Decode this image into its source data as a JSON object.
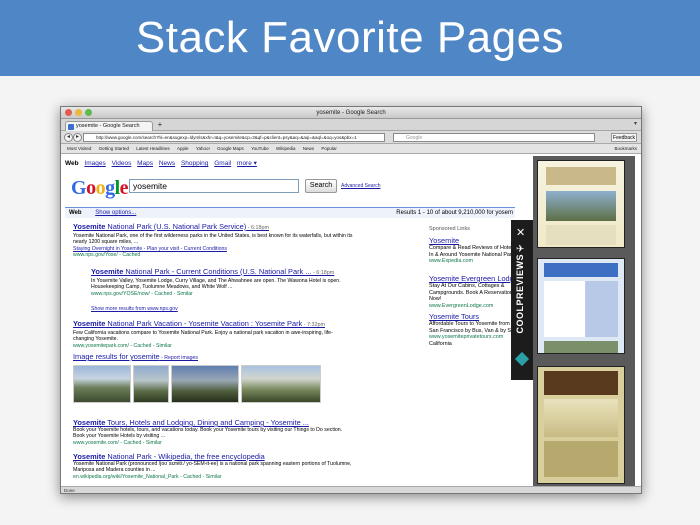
{
  "banner": {
    "title": "Stack Favorite Pages"
  },
  "browser": {
    "window_title": "yosemite - Google Search",
    "tab_title": "yosemite - Google Search",
    "url": "http://www.google.com/search?hl=en&sugexp=ldymls&xhr=t&q=yosemite&cp=3&qf=p&client=psy&aq=&aqi=&aql=&oq=yos&pbx=1",
    "search_placeholder": "Google",
    "feedback_label": "Feedback",
    "bookmarks": [
      "Most Visited",
      "Getting Started",
      "Latest Headlines",
      "Apple",
      "Yahoo!",
      "Google Maps",
      "YouTube",
      "Wikipedia",
      "News",
      "Popular"
    ],
    "bookmarks_right": "Bookmarks",
    "status_text": "Done"
  },
  "google": {
    "nav": [
      "Web",
      "Images",
      "Videos",
      "Maps",
      "News",
      "Shopping",
      "Gmail",
      "more ▾"
    ],
    "logo": "Google",
    "query": "yosemite",
    "search_button": "Search",
    "advanced_link": "Advanced Search",
    "web_label": "Web",
    "show_options": "Show options...",
    "results_summary": "Results 1 - 10 of about 9,210,000 for yosem"
  },
  "results": [
    {
      "title_pre": "Yosemite",
      "title_rest": " National Park (U.S. National Park Service)",
      "time": " - 6:18pm",
      "snippet": "Yosemite National Park, one of the first wilderness parks in the United States, is best known for its waterfalls, but within its nearly 1200 square miles, ...",
      "links": "Staying Overnight in Yosemite - Plan your visit - Current Conditions",
      "url": "www.nps.gov/Yose/ - Cached"
    },
    {
      "title_pre": "Yosemite",
      "title_rest": " National Park - Current Conditions (U.S. National Park ...",
      "time": " - 6:18pm",
      "snippet": "In Yosemite Valley, Yosemite Lodge, Curry Village, and The Ahwahnee are open. The Wawona Hotel is open. Housekeeping Camp, Tuolumne Meadows, and White Wolf ...",
      "url": "www.nps.gov/YOSE/now/ - Cached - Similar"
    },
    {
      "more": "Show more results from www.nps.gov"
    },
    {
      "title_pre": "Yosemite",
      "title_rest": " National Park Vacation - Yosemite Vacation : Yosemite Park",
      "time": " - 7:32pm",
      "snippet": "Few California vacations compare to Yosemite National Park. Enjoy a national park vacation in awe-inspiring, life-changing Yosemite.",
      "url": "www.yosemitepark.com/ - Cached - Similar"
    },
    {
      "image_results": "Image results for yosemite",
      "report": " - Report images"
    },
    {
      "title_pre": "Yosemite",
      "title_rest": " Tours, Hotels and Lodging, Dining and Camping - Yosemite ...",
      "snippet": "Book your Yosemite hotels, tours, and vacations today. Book your Yosemite tours by visiting our Things to Do section. Book your Yosemite Hotels by visiting ...",
      "url": "www.yosemite.com/ - Cached - Similar"
    },
    {
      "title_pre": "Yosemite",
      "title_rest": " National Park - Wikipedia, the free encyclopedia",
      "snippet": "Yosemite National Park (pronounced /joʊˈsɛmɨtiː/ yo-SEM-it-ee) is a national park spanning eastern portions of Tuolumne, Mariposa and Madera counties in ...",
      "url": "en.wikipedia.org/wiki/Yosemite_National_Park - Cached - Similar"
    }
  ],
  "ads": {
    "label": "Sponsored Links",
    "items": [
      {
        "title": "Yosemite",
        "text": "Compare & Read Reviews of Hotels In & Around Yosemite National Park!",
        "url": "www.Expedia.com"
      },
      {
        "title": "Yosemite Evergreen Lodge",
        "text": "Stay At Our Cabins, Cottages & Campgrounds. Book A Reservation Now!",
        "url": "www.EvergreenLodge.com"
      },
      {
        "title": "Yosemite Tours",
        "text": "Affordable Tours to Yosemite from San Francisco by Bus, Van & by SUV",
        "url": "www.yosemiteprivatetours.com",
        "extra": "California"
      }
    ]
  },
  "coolpreviews": {
    "brand": "COOLPREVIEWS",
    "close_icon": "×",
    "pin_icon": "pin"
  },
  "colors": {
    "banner": "#4f86c6",
    "link": "#1a1aa6",
    "url_green": "#0e774a",
    "panel": "#1c1c1c"
  }
}
